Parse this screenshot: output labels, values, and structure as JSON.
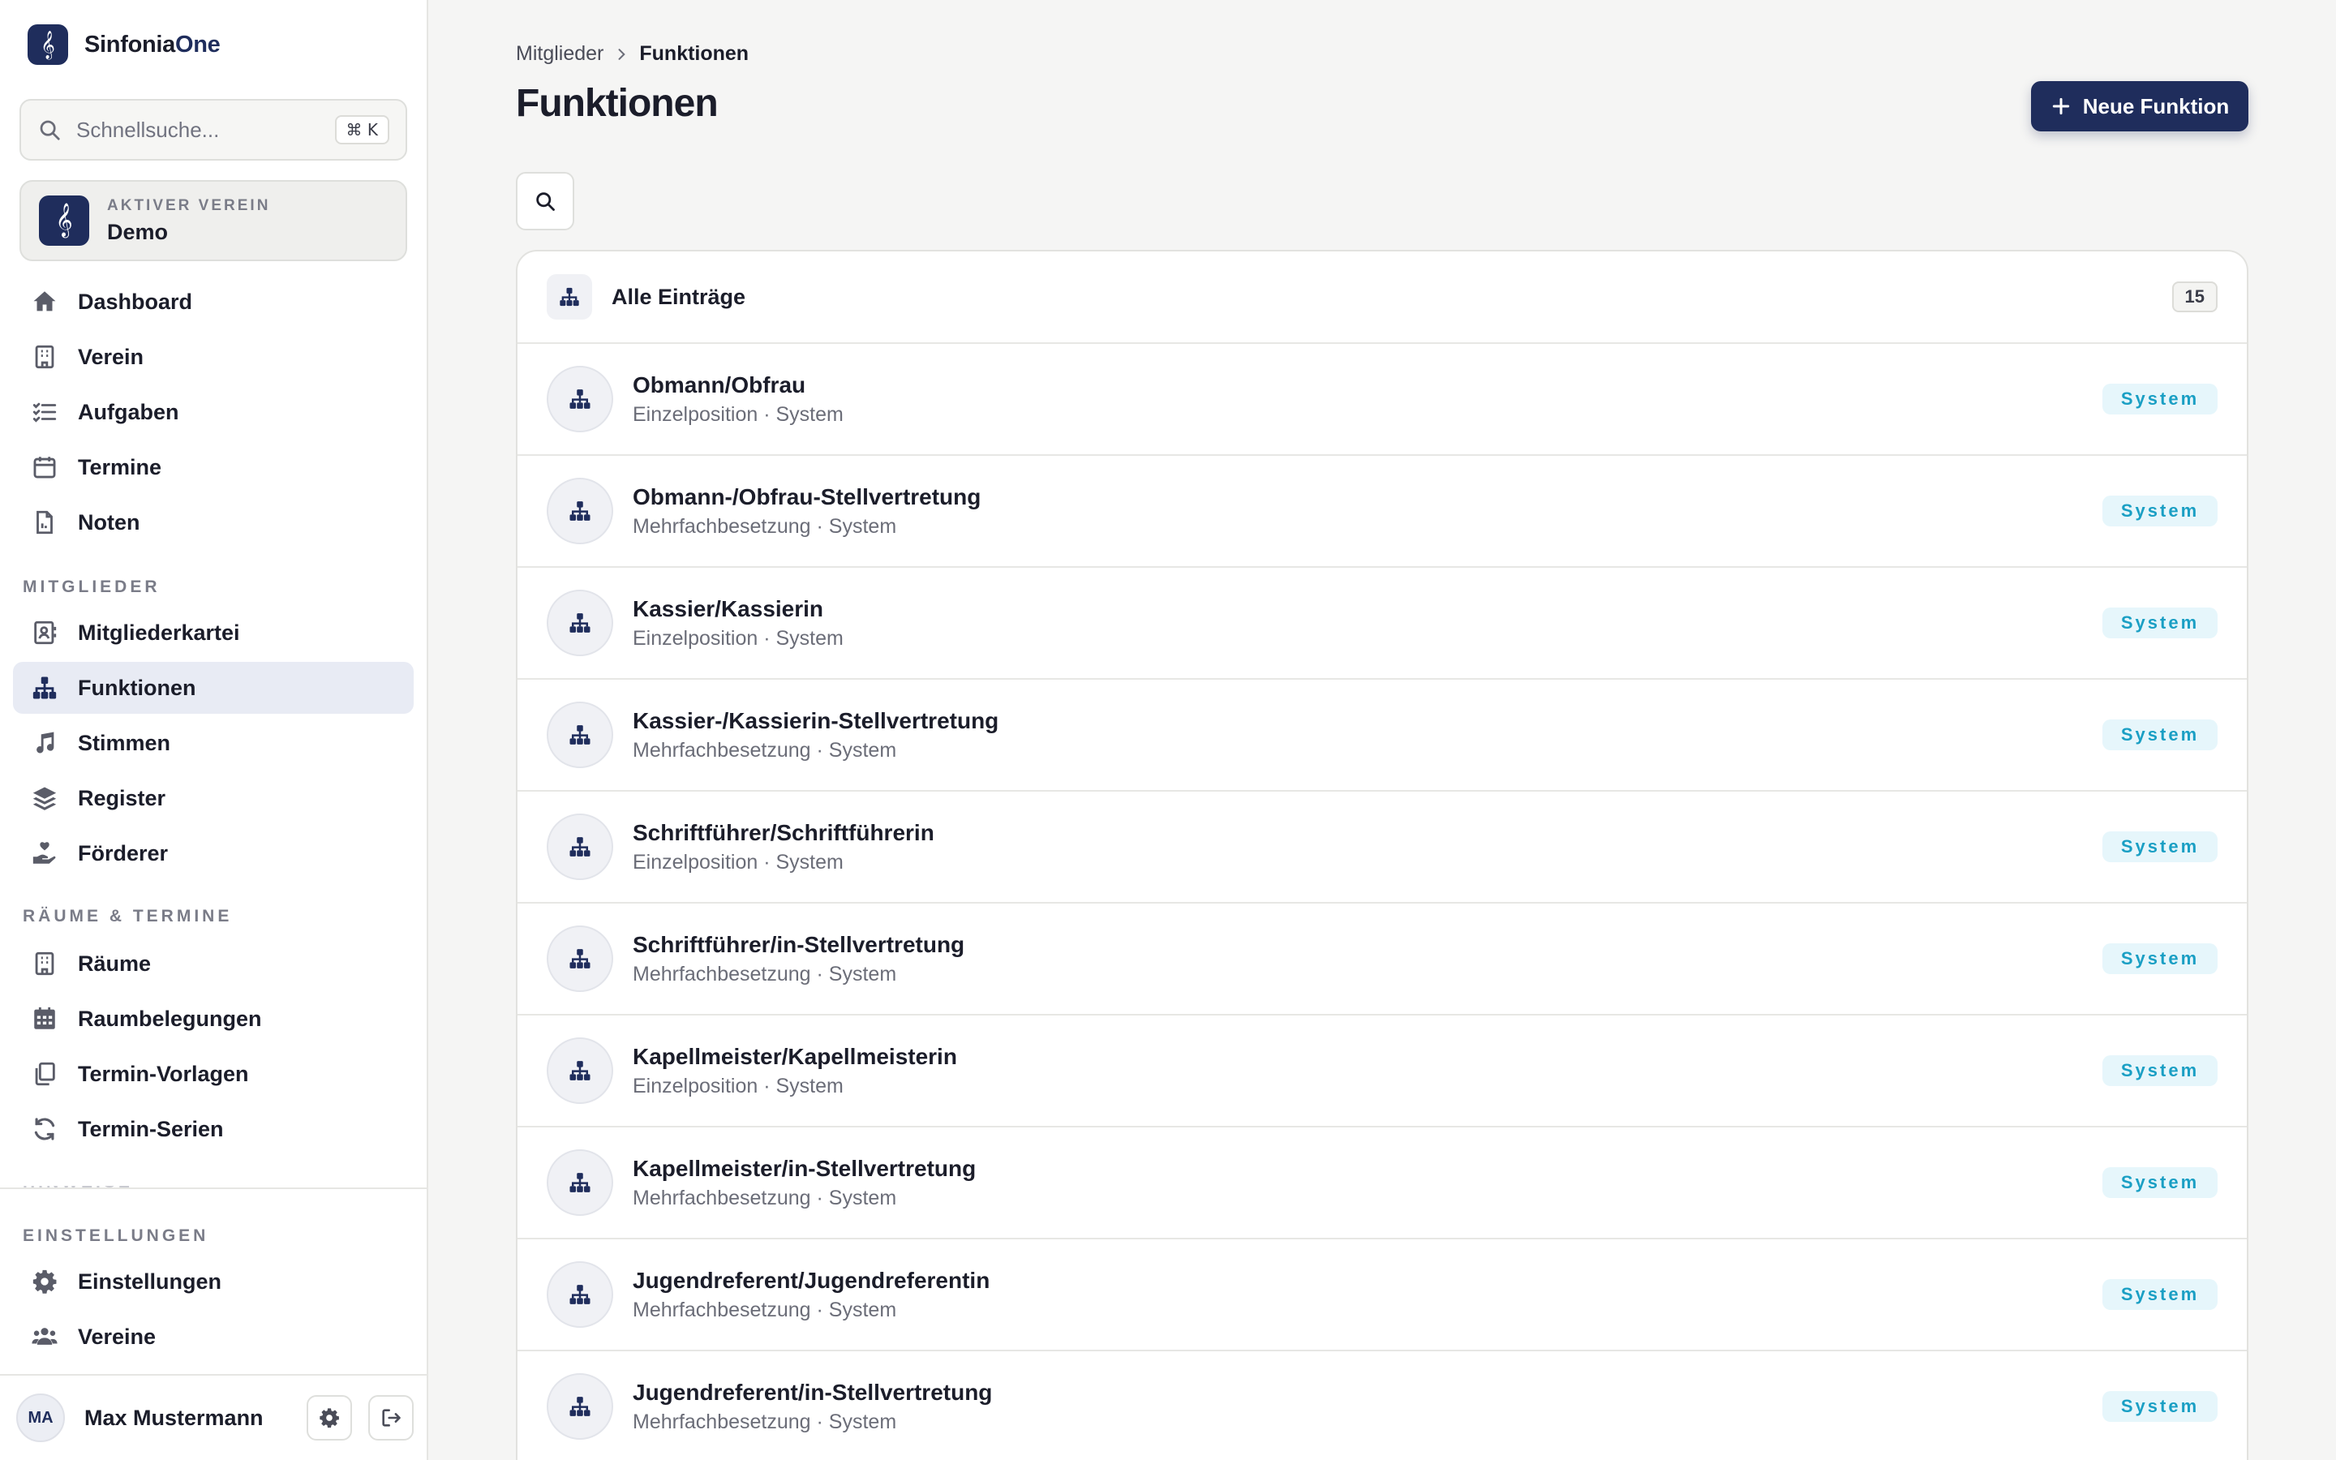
{
  "app": {
    "name_primary": "Sinfonia",
    "name_accent": "One"
  },
  "search": {
    "placeholder": "Schnellsuche...",
    "shortcut": "⌘ K"
  },
  "club": {
    "label": "AKTIVER VEREIN",
    "name": "Demo"
  },
  "nav": {
    "main": [
      {
        "label": "Dashboard",
        "icon": "home-icon"
      },
      {
        "label": "Verein",
        "icon": "building-icon"
      },
      {
        "label": "Aufgaben",
        "icon": "checklist-icon"
      },
      {
        "label": "Termine",
        "icon": "calendar-icon"
      },
      {
        "label": "Noten",
        "icon": "document-icon"
      }
    ],
    "sections": [
      {
        "title": "MITGLIEDER",
        "items": [
          {
            "label": "Mitgliederkartei",
            "icon": "contact-card-icon"
          },
          {
            "label": "Funktionen",
            "icon": "hierarchy-icon",
            "active": true
          },
          {
            "label": "Stimmen",
            "icon": "music-note-icon"
          },
          {
            "label": "Register",
            "icon": "layers-icon"
          },
          {
            "label": "Förderer",
            "icon": "hand-heart-icon"
          }
        ]
      },
      {
        "title": "RÄUME & TERMINE",
        "items": [
          {
            "label": "Räume",
            "icon": "building-icon"
          },
          {
            "label": "Raumbelegungen",
            "icon": "calendar-grid-icon"
          },
          {
            "label": "Termin-Vorlagen",
            "icon": "copy-icon"
          },
          {
            "label": "Termin-Serien",
            "icon": "refresh-icon"
          }
        ]
      },
      {
        "title": "EINSTELLUNGEN",
        "items": [
          {
            "label": "Einstellungen",
            "icon": "gear-icon"
          },
          {
            "label": "Vereine",
            "icon": "users-icon"
          }
        ]
      }
    ],
    "faded_section_label": "HINWEISE"
  },
  "user": {
    "initials": "MA",
    "name": "Max Mustermann"
  },
  "breadcrumb": {
    "parent": "Mitglieder",
    "current": "Funktionen"
  },
  "page": {
    "title": "Funktionen",
    "new_button": "Neue Funktion"
  },
  "list": {
    "header_title": "Alle Einträge",
    "count": "15",
    "rows": [
      {
        "title": "Obmann/Obfrau",
        "subtitle": "Einzelposition · System",
        "badge": "System"
      },
      {
        "title": "Obmann-/Obfrau-Stellvertretung",
        "subtitle": "Mehrfachbesetzung · System",
        "badge": "System"
      },
      {
        "title": "Kassier/Kassierin",
        "subtitle": "Einzelposition · System",
        "badge": "System"
      },
      {
        "title": "Kassier-/Kassierin-Stellvertretung",
        "subtitle": "Mehrfachbesetzung · System",
        "badge": "System"
      },
      {
        "title": "Schriftführer/Schriftführerin",
        "subtitle": "Einzelposition · System",
        "badge": "System"
      },
      {
        "title": "Schriftführer/in-Stellvertretung",
        "subtitle": "Mehrfachbesetzung · System",
        "badge": "System"
      },
      {
        "title": "Kapellmeister/Kapellmeisterin",
        "subtitle": "Einzelposition · System",
        "badge": "System"
      },
      {
        "title": "Kapellmeister/in-Stellvertretung",
        "subtitle": "Mehrfachbesetzung · System",
        "badge": "System"
      },
      {
        "title": "Jugendreferent/Jugendreferentin",
        "subtitle": "Mehrfachbesetzung · System",
        "badge": "System"
      },
      {
        "title": "Jugendreferent/in-Stellvertretung",
        "subtitle": "Mehrfachbesetzung · System",
        "badge": "System"
      }
    ]
  },
  "colors": {
    "brand": "#1f2d5c",
    "badge_text": "#1a9fc4",
    "badge_bg": "#e6f6fb",
    "active_nav_bg": "#e8ebf4"
  }
}
